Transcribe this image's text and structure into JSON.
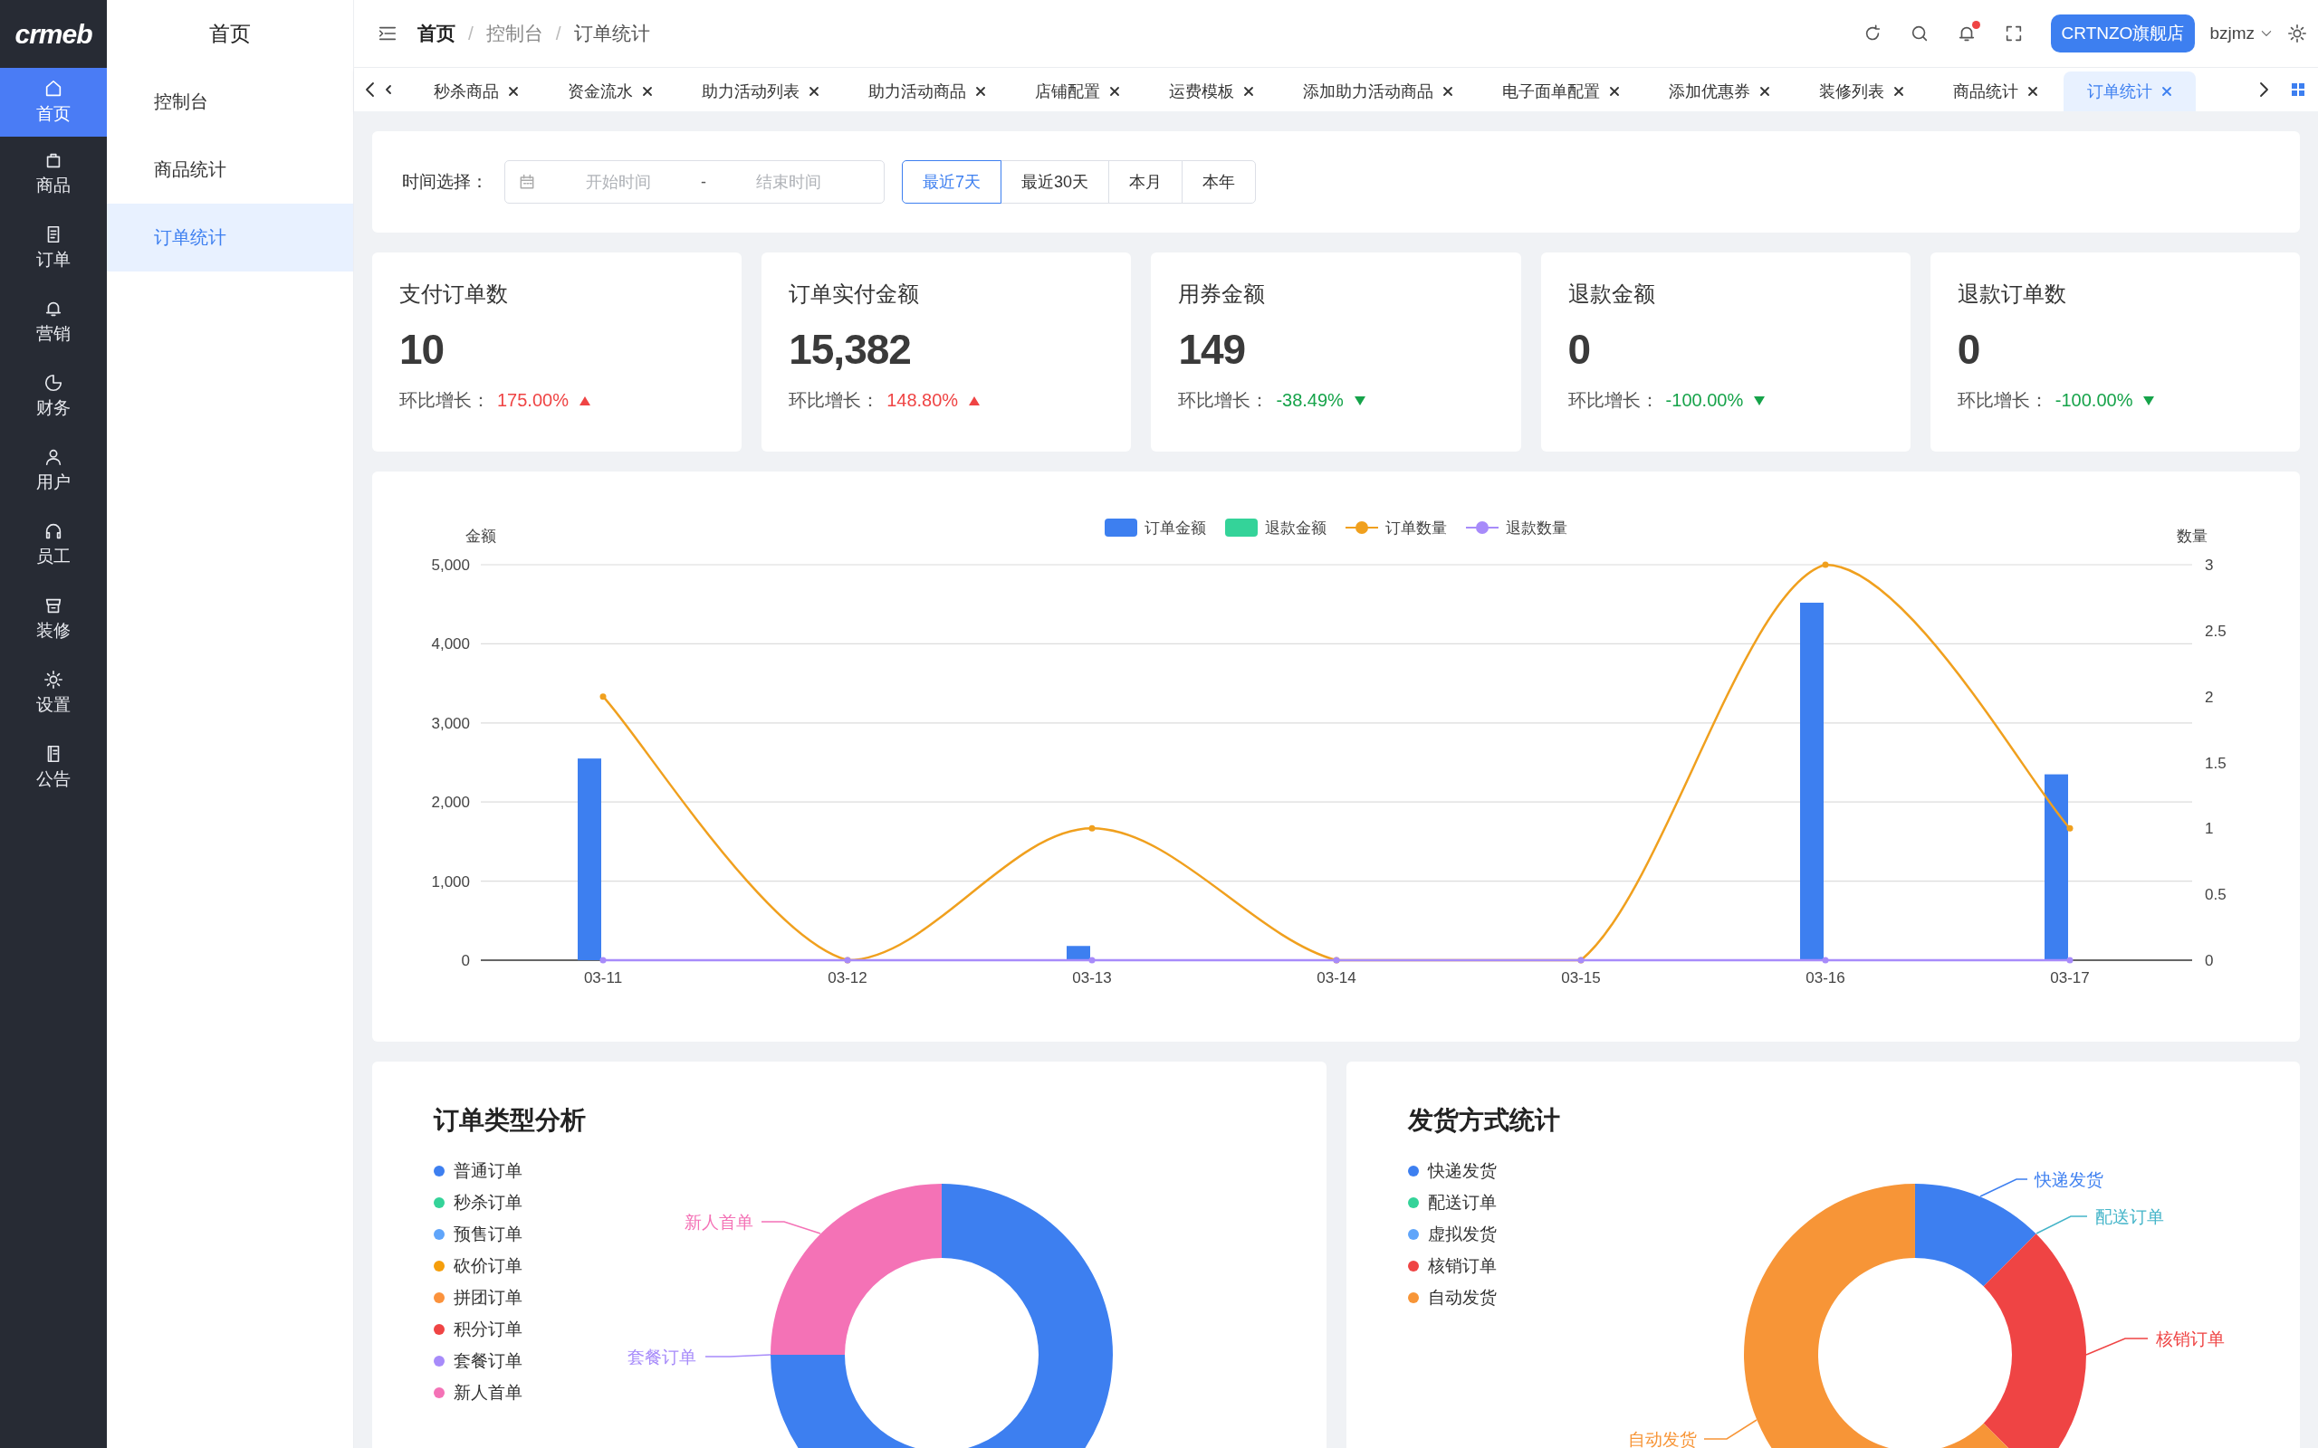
{
  "logo": "crmeb",
  "nav": [
    {
      "label": "首页",
      "selected": true
    },
    {
      "label": "商品",
      "selected": false
    },
    {
      "label": "订单",
      "selected": false
    },
    {
      "label": "营销",
      "selected": false
    },
    {
      "label": "财务",
      "selected": false
    },
    {
      "label": "用户",
      "selected": false
    },
    {
      "label": "员工",
      "selected": false
    },
    {
      "label": "装修",
      "selected": false
    },
    {
      "label": "设置",
      "selected": false
    },
    {
      "label": "公告",
      "selected": false
    }
  ],
  "subnav": {
    "title": "首页",
    "items": [
      {
        "label": "控制台",
        "selected": false
      },
      {
        "label": "商品统计",
        "selected": false
      },
      {
        "label": "订单统计",
        "selected": true
      }
    ]
  },
  "breadcrumb": {
    "separator": "/",
    "items": [
      "首页",
      "控制台",
      "订单统计"
    ]
  },
  "header": {
    "notification_dot": true,
    "store_button": "CRTNZO旗舰店",
    "user": "bzjmz"
  },
  "tabs": [
    {
      "label": "秒杀商品",
      "selected": false
    },
    {
      "label": "资金流水",
      "selected": false
    },
    {
      "label": "助力活动列表",
      "selected": false
    },
    {
      "label": "助力活动商品",
      "selected": false
    },
    {
      "label": "店铺配置",
      "selected": false
    },
    {
      "label": "运费模板",
      "selected": false
    },
    {
      "label": "添加助力活动商品",
      "selected": false
    },
    {
      "label": "电子面单配置",
      "selected": false
    },
    {
      "label": "添加优惠券",
      "selected": false
    },
    {
      "label": "装修列表",
      "selected": false
    },
    {
      "label": "商品统计",
      "selected": false
    },
    {
      "label": "订单统计",
      "selected": true
    }
  ],
  "filter": {
    "label": "时间选择：",
    "start_placeholder": "开始时间",
    "separator": "-",
    "end_placeholder": "结束时间",
    "ranges": [
      {
        "label": "最近7天",
        "selected": true
      },
      {
        "label": "最近30天",
        "selected": false
      },
      {
        "label": "本月",
        "selected": false
      },
      {
        "label": "本年",
        "selected": false
      }
    ]
  },
  "stats": [
    {
      "title": "支付订单数",
      "value": "10",
      "growth_label": "环比增长：",
      "growth": "175.00%",
      "rising": true
    },
    {
      "title": "订单实付金额",
      "value": "15,382",
      "growth_label": "环比增长：",
      "growth": "148.80%",
      "rising": true
    },
    {
      "title": "用券金额",
      "value": "149",
      "growth_label": "环比增长：",
      "growth": "-38.49%",
      "rising": false
    },
    {
      "title": "退款金额",
      "value": "0",
      "growth_label": "环比增长：",
      "growth": "-100.00%",
      "rising": false
    },
    {
      "title": "退款订单数",
      "value": "0",
      "growth_label": "环比增长：",
      "growth": "-100.00%",
      "rising": false
    }
  ],
  "trend_chart": {
    "chart_data": {
      "type": "bar",
      "ylabel": "金额",
      "y2label": "数量",
      "categories": [
        "03-11",
        "03-12",
        "03-13",
        "03-14",
        "03-15",
        "03-16",
        "03-17"
      ],
      "series": [
        {
          "name": "订单金额",
          "color": "#3d7ff0",
          "values": [
            2550,
            0,
            180,
            0,
            0,
            4520,
            2350
          ]
        },
        {
          "name": "退款金额",
          "color": "#34d399",
          "values": [
            0,
            0,
            0,
            0,
            0,
            0,
            0
          ]
        },
        {
          "name": "订单数量",
          "color": "#f0a01e",
          "type": "line",
          "axis": "y2",
          "marker": "o",
          "values": [
            2,
            0,
            1,
            0,
            0,
            3,
            1
          ]
        },
        {
          "name": "退款数量",
          "color": "#a78bfa",
          "type": "line",
          "axis": "y2",
          "marker": "o",
          "values": [
            0,
            0,
            0,
            0,
            0,
            0,
            0
          ]
        }
      ],
      "grid": true,
      "legend": true,
      "ylim": [
        0,
        5000
      ],
      "yticks": [
        0,
        {
          "value": 1000,
          "label": "1,000"
        },
        {
          "value": 2000,
          "label": "2,000"
        },
        {
          "value": 3000,
          "label": "3,000"
        },
        {
          "value": 4000,
          "label": "4,000"
        },
        {
          "value": 5000,
          "label": "5,000"
        }
      ],
      "y2lim": [
        0,
        3
      ],
      "y2ticks": [
        0,
        0.5,
        1,
        1.5,
        2,
        2.5,
        3
      ]
    }
  },
  "order_types": {
    "title": "订单类型分析",
    "legend": [
      {
        "label": "普通订单",
        "color": "#3d7ff0"
      },
      {
        "label": "秒杀订单",
        "color": "#34d399"
      },
      {
        "label": "预售订单",
        "color": "#60a5fa"
      },
      {
        "label": "砍价订单",
        "color": "#f59e0b"
      },
      {
        "label": "拼团订单",
        "color": "#fb923c"
      },
      {
        "label": "积分订单",
        "color": "#ef4444"
      },
      {
        "label": "套餐订单",
        "color": "#a78bfa"
      },
      {
        "label": "新人首单",
        "color": "#f472b6"
      }
    ],
    "labels": [
      {
        "text": "新人首单",
        "color": "#f472b6"
      },
      {
        "text": "套餐订单",
        "color": "#a78bfa"
      }
    ]
  },
  "shipping": {
    "title": "发货方式统计",
    "legend": [
      {
        "label": "快递发货",
        "color": "#3d7ff0"
      },
      {
        "label": "配送订单",
        "color": "#34d399"
      },
      {
        "label": "虚拟发货",
        "color": "#60a5fa"
      },
      {
        "label": "核销订单",
        "color": "#ef4444"
      },
      {
        "label": "自动发货",
        "color": "#f79537"
      }
    ],
    "labels": [
      {
        "text": "快递发货",
        "color": "#3d7ff0"
      },
      {
        "text": "配送订单",
        "color": "#45b5c9"
      },
      {
        "text": "核销订单",
        "color": "#ef4444"
      },
      {
        "text": "自动发货",
        "color": "#f79537"
      }
    ]
  }
}
